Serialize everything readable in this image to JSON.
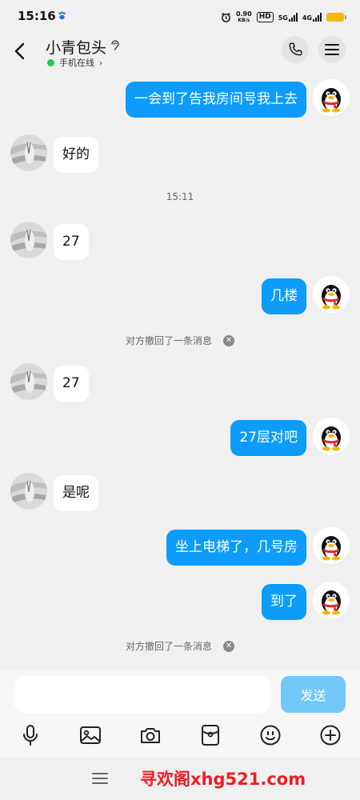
{
  "status_bar": {
    "time": "15:16",
    "net_speed_value": "0.90",
    "net_speed_unit": "KB/s",
    "hd_label": "HD",
    "sim1_label": "5G",
    "sim2_label": "4G",
    "battery_color": "#f5b800"
  },
  "header": {
    "contact_name": "小青包头",
    "status_text": "手机在线",
    "online_color": "#27c85a"
  },
  "messages": [
    {
      "direction": "out",
      "text": "一会到了告我房间号我上去"
    },
    {
      "direction": "in",
      "text": "好的"
    },
    {
      "type": "time",
      "text": "15:11"
    },
    {
      "direction": "in",
      "text": "27"
    },
    {
      "direction": "out",
      "text": "几楼"
    },
    {
      "type": "recall",
      "text": "对方撤回了一条消息"
    },
    {
      "direction": "in",
      "text": "27"
    },
    {
      "direction": "out",
      "text": "27层对吧"
    },
    {
      "direction": "in",
      "text": "是呢"
    },
    {
      "direction": "out",
      "text": "坐上电梯了，几号房"
    },
    {
      "direction": "out",
      "text": "到了"
    },
    {
      "type": "recall",
      "text": "对方撤回了一条消息"
    }
  ],
  "input": {
    "value": "",
    "placeholder": "",
    "send_label": "发送"
  },
  "toolbar_icons": [
    "mic-icon",
    "image-icon",
    "camera-icon",
    "red-packet-icon",
    "emoji-icon",
    "plus-icon"
  ],
  "watermark": "寻欢阁xhg521.com",
  "colors": {
    "outgoing_bubble": "#0d9cf9",
    "incoming_bubble": "#ffffff",
    "send_button": "#72c8f8",
    "background": "#f0f0f0",
    "watermark": "#ee1c25"
  }
}
